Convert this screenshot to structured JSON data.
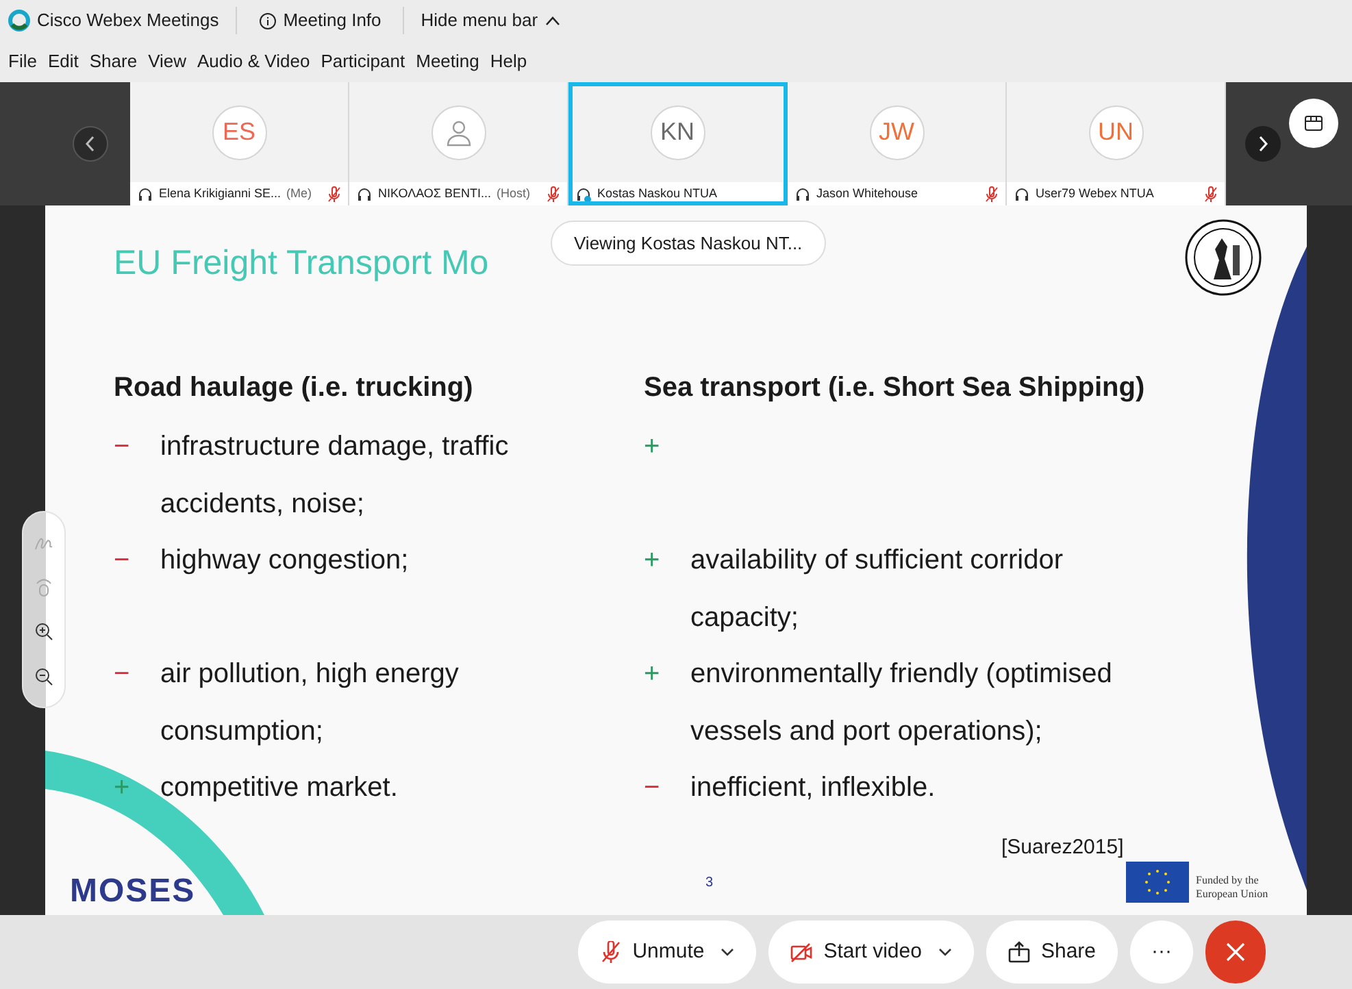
{
  "title_bar": {
    "app_name": "Cisco Webex Meetings",
    "meeting_info": "Meeting Info",
    "hide_menu": "Hide menu bar"
  },
  "menu": [
    "File",
    "Edit",
    "Share",
    "View",
    "Audio & Video",
    "Participant",
    "Meeting",
    "Help"
  ],
  "participants": [
    {
      "initials": "ES",
      "name": "Elena Krikigianni SE...",
      "role": "(Me)",
      "color": "#ea6a55",
      "muted": true,
      "selected": false
    },
    {
      "name": "ΝΙΚΟΛΑΟΣ ΒΕΝΤΙ...",
      "role": "(Host)",
      "muted": true,
      "selected": false
    },
    {
      "initials": "KN",
      "name": "Kostas Naskou NTUA",
      "color": "#6b6b6b",
      "muted": false,
      "selected": true
    },
    {
      "initials": "JW",
      "name": "Jason Whitehouse",
      "color": "#f0703a",
      "muted": true,
      "selected": false
    },
    {
      "initials": "UN",
      "name": "User79 Webex NTUA",
      "color": "#f0703a",
      "muted": true,
      "selected": false
    }
  ],
  "viewing_label": "Viewing Kostas Naskou NT...",
  "slide": {
    "title": "EU Freight Transport Mo",
    "columns": [
      {
        "heading": "Road haulage (i.e. trucking)",
        "items": [
          {
            "kind": "minus",
            "marker": "−",
            "text": "infrastructure damage, traffic accidents, noise;"
          },
          {
            "kind": "minus",
            "marker": "−",
            "text": "highway congestion;"
          },
          {
            "kind": "minus",
            "marker": "−",
            "text": "air pollution, high energy consumption;"
          },
          {
            "kind": "plus",
            "marker": "+",
            "text": "competitive market."
          }
        ]
      },
      {
        "heading": "Sea transport (i.e. Short Sea Shipping)",
        "items": [
          {
            "kind": "plus",
            "marker": "+"
          },
          {
            "kind": "plus",
            "marker": "+",
            "text": "availability of sufficient corridor capacity;"
          },
          {
            "kind": "plus",
            "marker": "+",
            "text": "environmentally friendly (optimised vessels and port operations);"
          },
          {
            "kind": "minus",
            "marker": "−",
            "text": "inefficient, inflexible."
          }
        ]
      }
    ],
    "citation": "[Suarez2015]",
    "logo_text": "MOSES",
    "page_number": "3",
    "funding": "Funded by the European Union"
  },
  "controls": [
    {
      "kind": "mute",
      "label": "Unmute",
      "dropdown": true
    },
    {
      "kind": "video",
      "label": "Start video",
      "dropdown": true
    },
    {
      "kind": "share",
      "label": "Share",
      "dropdown": false
    },
    {
      "kind": "more",
      "label": "···",
      "dropdown": false
    },
    {
      "kind": "end",
      "dropdown": false
    }
  ]
}
